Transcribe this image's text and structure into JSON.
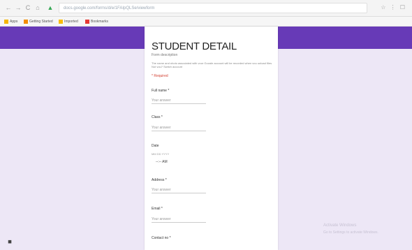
{
  "browser": {
    "nav_back": "←",
    "nav_forward": "→",
    "nav_reload": "C",
    "nav_home": "⌂",
    "secure": "▲",
    "url": "docs.google.com/forms/d/e/1FAIpQLSe/viewform",
    "right_icons": "☆ ⋮ ☐"
  },
  "bookmarks": [
    {
      "label": "Apps",
      "color": "#f4b400"
    },
    {
      "label": "Getting Started",
      "color": "#f28c00"
    },
    {
      "label": "Imported",
      "color": "#fbbc05"
    },
    {
      "label": "Bookmarks",
      "color": "#e53935"
    }
  ],
  "form": {
    "title": "STUDENT DETAIL",
    "subtitle": "Form description",
    "info_line_1": "The name and photo associated with your Google account will be recorded when you upload files and submit this form.",
    "info_line_2": "Not you? Switch account",
    "required_note": "* Required",
    "fields": [
      {
        "label": "Full name *",
        "answer": "Your answer"
      },
      {
        "label": "Class *",
        "answer": "Your answer"
      },
      {
        "label": "Date",
        "answer": ""
      },
      {
        "label": "Address *",
        "answer": "Your answer"
      },
      {
        "label": "Email *",
        "answer": "Your answer"
      },
      {
        "label": "Contact no *",
        "answer": ""
      }
    ],
    "date_row": "MM   DD   YYYY",
    "time_value": "--:-- AM"
  },
  "watermark": {
    "line1": "Activate Windows",
    "line2": "Go to Settings to activate Windows."
  },
  "footer_icon": "help-icon",
  "colors": {
    "header_purple": "#673ab7",
    "background": "#ede7f6"
  }
}
